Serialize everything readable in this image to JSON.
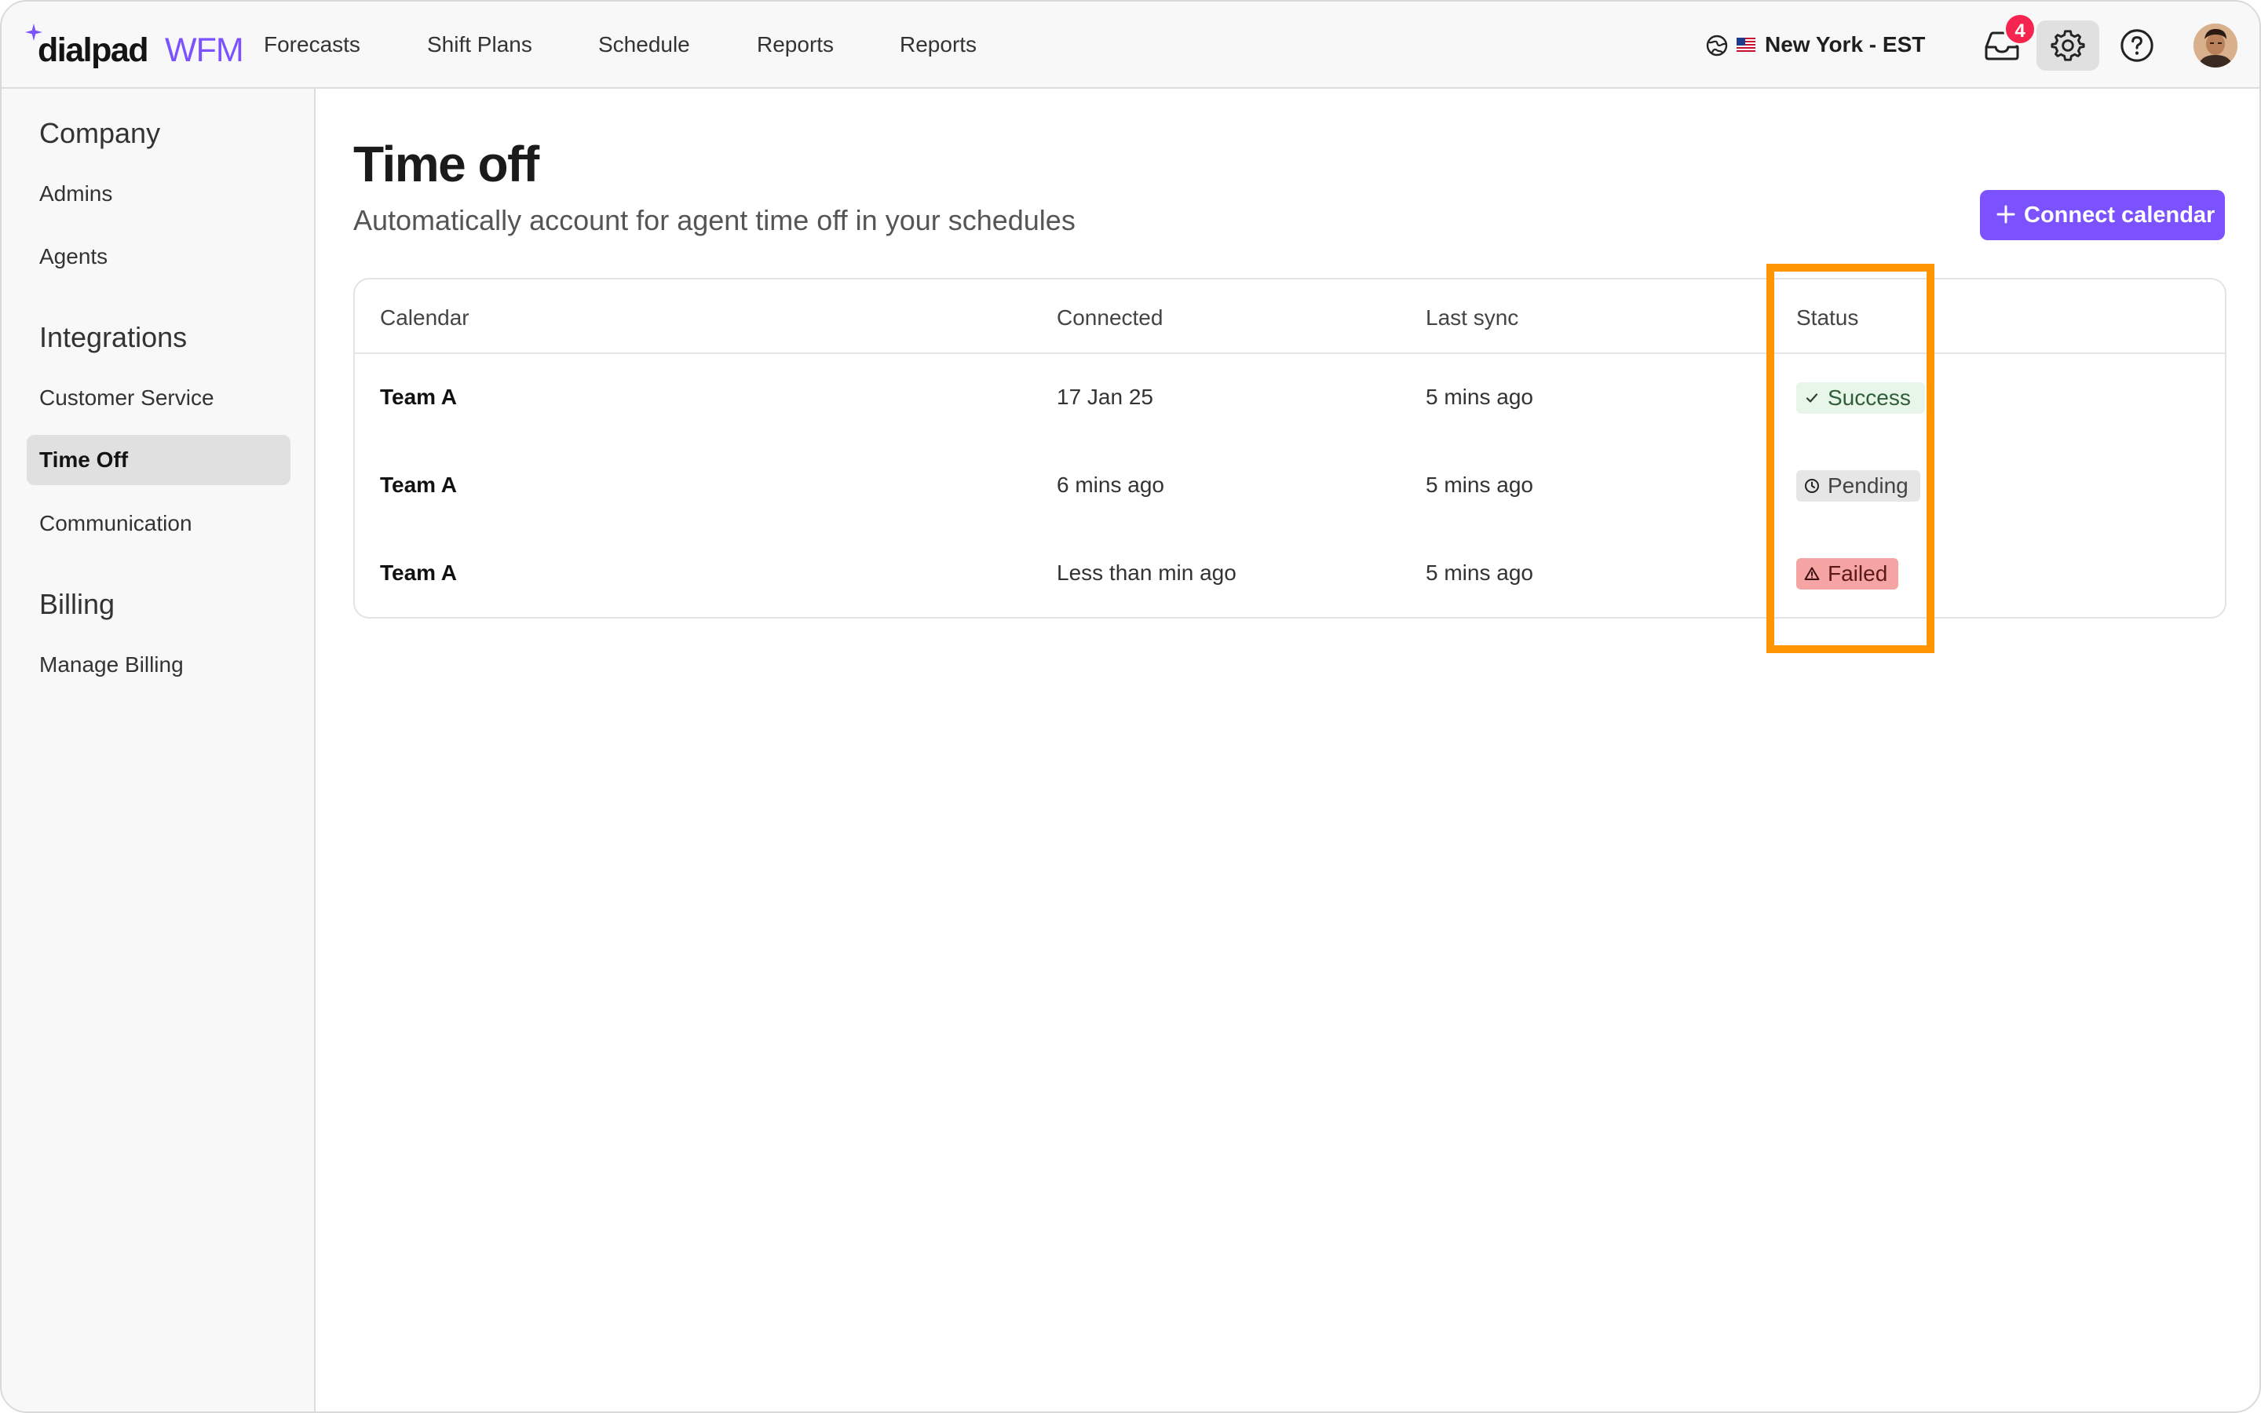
{
  "brand": {
    "name_part1": "dialpad",
    "name_part2": "WFM",
    "accent_color": "#7c52ff"
  },
  "nav": {
    "items": [
      {
        "label": "Forecasts"
      },
      {
        "label": "Shift Plans"
      },
      {
        "label": "Schedule"
      },
      {
        "label": "Reports"
      },
      {
        "label": "Reports"
      }
    ]
  },
  "header": {
    "timezone_label": "New York - EST",
    "timezone_flag": "us-flag",
    "notification_count": "4",
    "icons": [
      "globe-icon",
      "inbox-icon",
      "gear-icon",
      "help-icon",
      "avatar"
    ]
  },
  "sidebar": {
    "sections": [
      {
        "heading": "Company",
        "items": [
          {
            "label": "Admins"
          },
          {
            "label": "Agents"
          }
        ]
      },
      {
        "heading": "Integrations",
        "items": [
          {
            "label": "Customer Service"
          },
          {
            "label": "Time Off",
            "active": true
          },
          {
            "label": "Communication"
          }
        ]
      },
      {
        "heading": "Billing",
        "items": [
          {
            "label": "Manage Billing"
          }
        ]
      }
    ]
  },
  "page": {
    "title": "Time off",
    "subtitle": "Automatically account for agent time off in your schedules",
    "connect_button_label": "Connect calendar"
  },
  "table": {
    "columns": [
      "Calendar",
      "Connected",
      "Last sync",
      "Status"
    ],
    "rows": [
      {
        "calendar": "Team A",
        "connected": "17 Jan 25",
        "last_sync": "5 mins ago",
        "status": "Success",
        "status_icon": "check-icon"
      },
      {
        "calendar": "Team A",
        "connected": "6 mins ago",
        "last_sync": "5 mins ago",
        "status": "Pending",
        "status_icon": "clock-icon"
      },
      {
        "calendar": "Team A",
        "connected": "Less than min ago",
        "last_sync": "5 mins ago",
        "status": "Failed",
        "status_icon": "warning-icon"
      }
    ]
  },
  "colors": {
    "highlight": "#ff9500",
    "success_bg": "#e8f6ea",
    "pending_bg": "#e6e6e6",
    "failed_bg": "#f5a3a3",
    "badge": "#f5254f"
  }
}
